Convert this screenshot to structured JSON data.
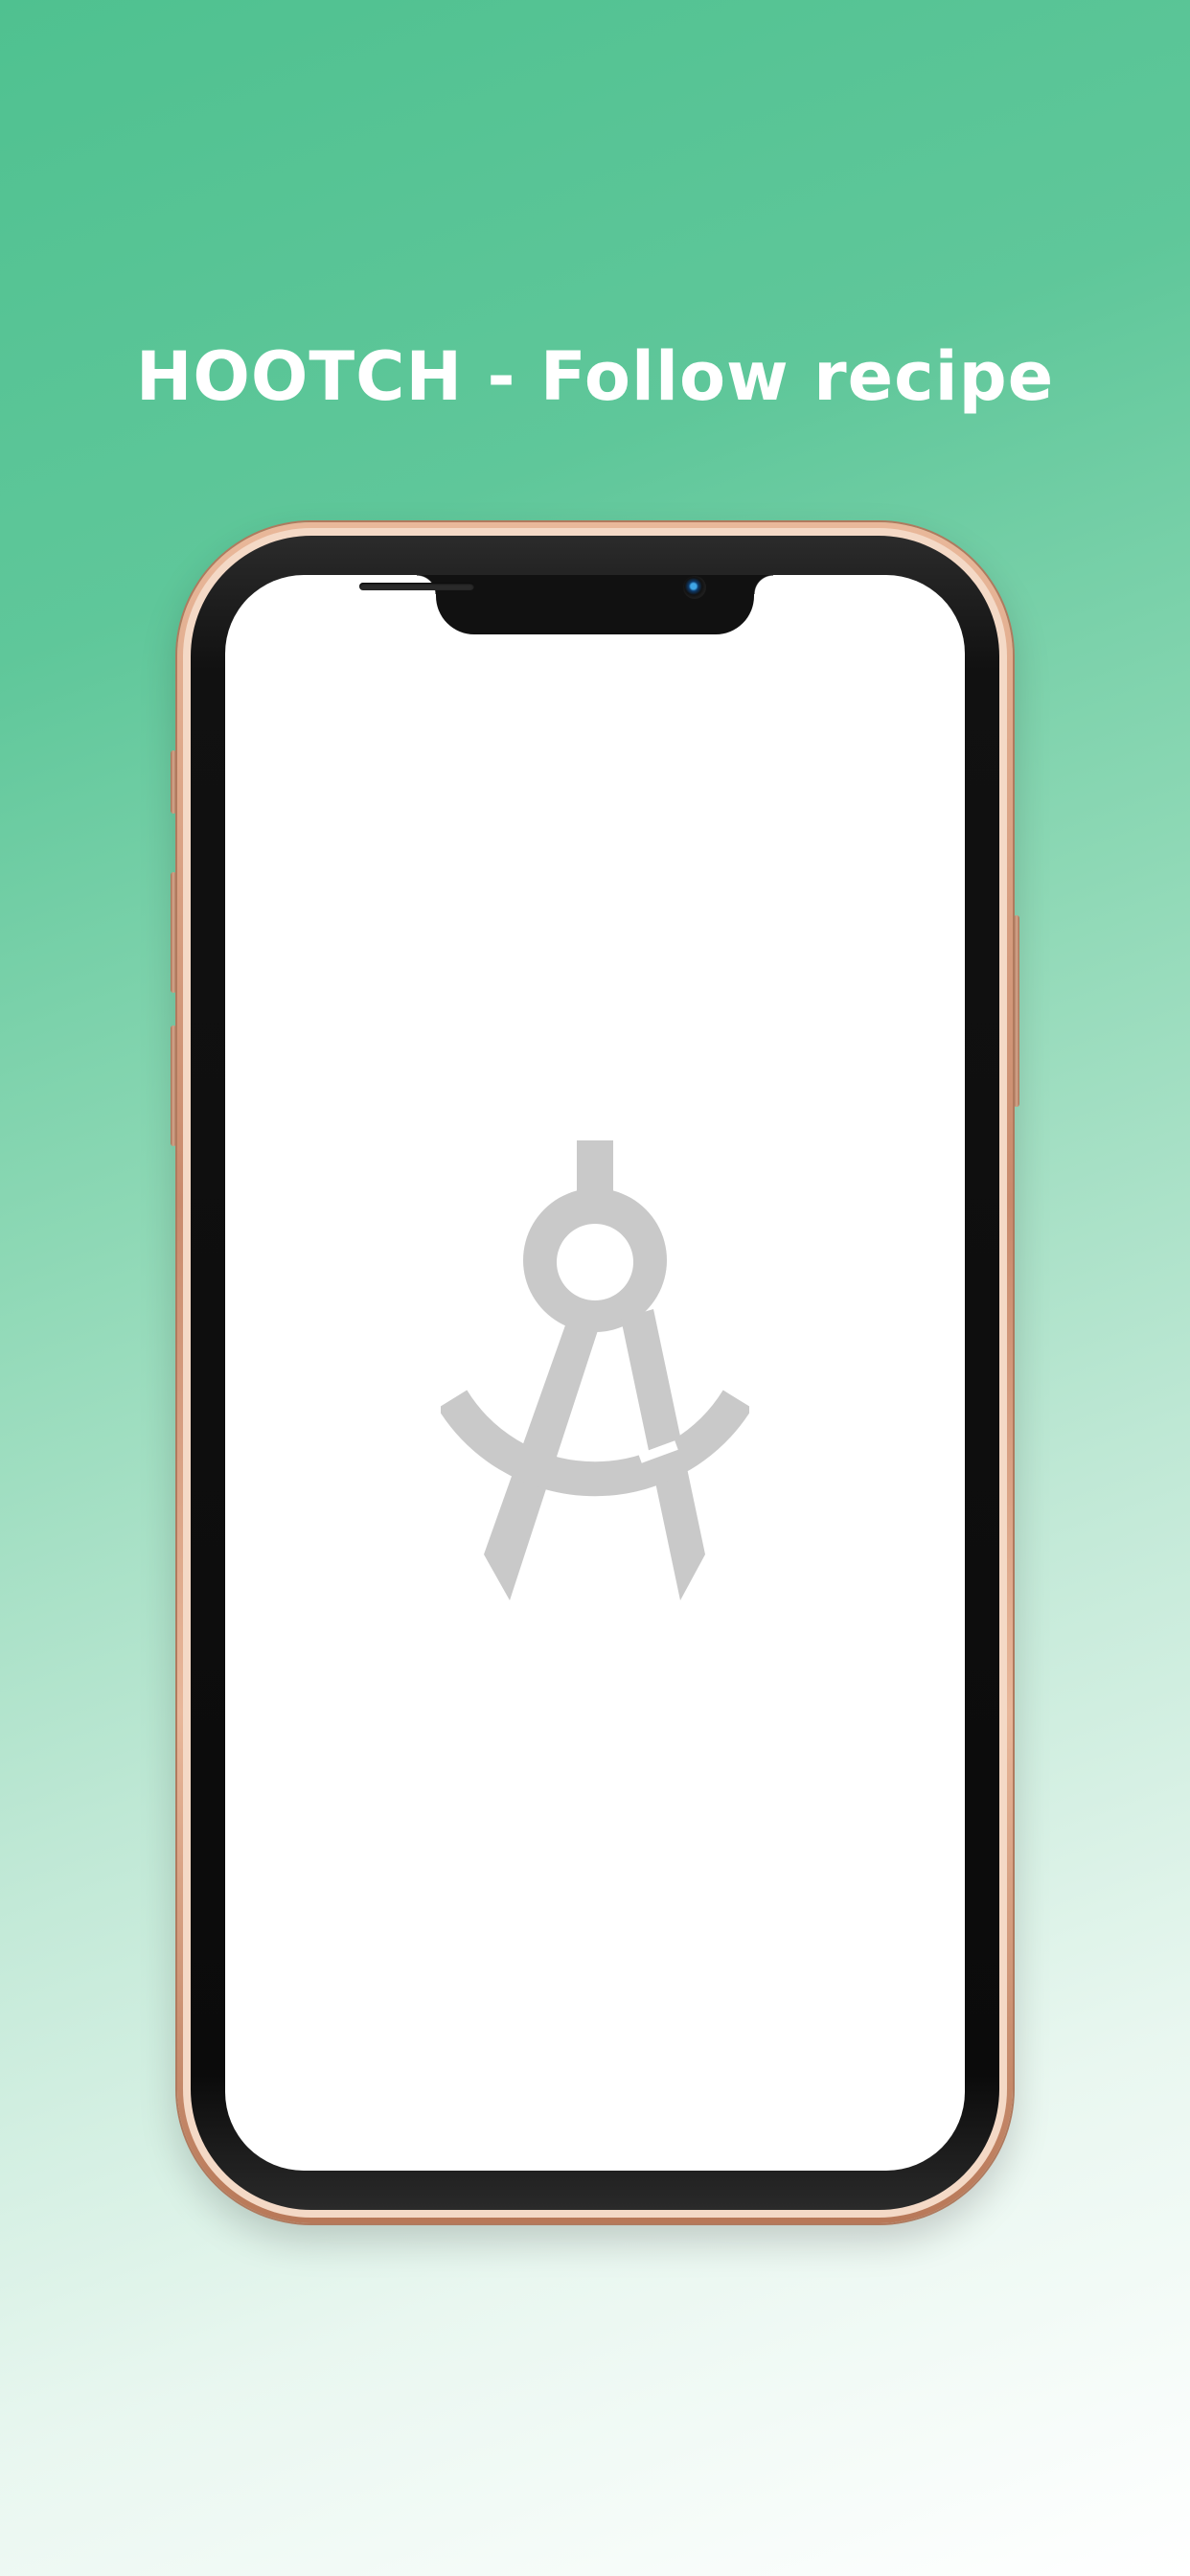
{
  "headline": "HOOTCH - Follow recipe",
  "colors": {
    "background_top": "#4fc190",
    "background_bottom": "#ffffff",
    "headline_text": "#ffffff",
    "screen": "#ffffff",
    "icon": "#c9c9c9",
    "phone_frame": "#d9a284"
  },
  "screen": {
    "icon": "compass-icon"
  }
}
